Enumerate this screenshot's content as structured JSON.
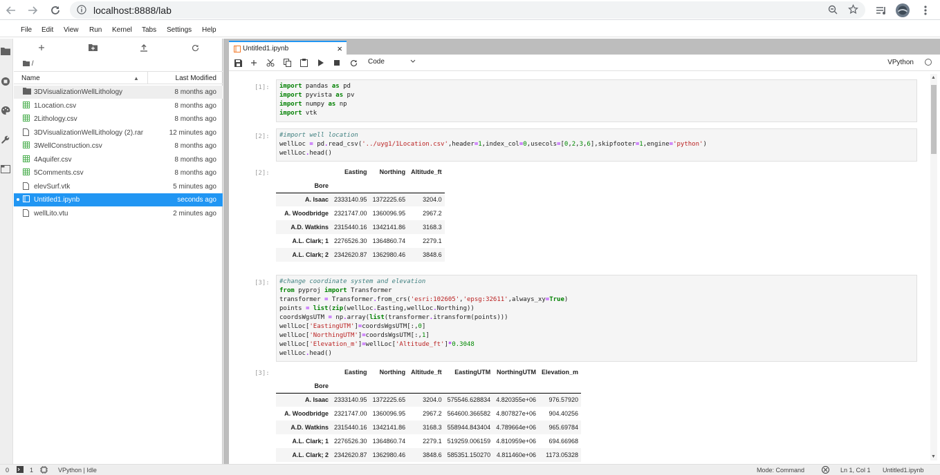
{
  "browser": {
    "url": "localhost:8888/lab"
  },
  "menubar": {
    "items": [
      "File",
      "Edit",
      "View",
      "Run",
      "Kernel",
      "Tabs",
      "Settings",
      "Help"
    ]
  },
  "filebrowser": {
    "breadcrumb": "/",
    "col_name": "Name",
    "col_modified": "Last Modified",
    "files": [
      {
        "name": "3DVisualizationWellLithology",
        "modified": "8 months ago",
        "kind": "folder"
      },
      {
        "name": "1Location.csv",
        "modified": "8 months ago",
        "kind": "csv"
      },
      {
        "name": "2Lithology.csv",
        "modified": "8 months ago",
        "kind": "csv"
      },
      {
        "name": "3DVisualizationWellLithology (2).rar",
        "modified": "12 minutes ago",
        "kind": "file"
      },
      {
        "name": "3WellConstruction.csv",
        "modified": "8 months ago",
        "kind": "csv"
      },
      {
        "name": "4Aquifer.csv",
        "modified": "8 months ago",
        "kind": "csv"
      },
      {
        "name": "5Comments.csv",
        "modified": "8 months ago",
        "kind": "csv"
      },
      {
        "name": "elevSurf.vtk",
        "modified": "5 minutes ago",
        "kind": "file"
      },
      {
        "name": "Untitled1.ipynb",
        "modified": "seconds ago",
        "kind": "notebook"
      },
      {
        "name": "wellLito.vtu",
        "modified": "2 minutes ago",
        "kind": "file"
      }
    ]
  },
  "tab": {
    "label": "Untitled1.ipynb",
    "close": "×"
  },
  "toolbar": {
    "cell_type": "Code",
    "kernel": "VPython"
  },
  "cells": {
    "c1_prompt": "[1]:",
    "c2_prompt": "[2]:",
    "o2_prompt": "[2]:",
    "c3_prompt": "[3]:",
    "o3_prompt": "[3]:"
  },
  "df1": {
    "columns": [
      "Easting",
      "Northing",
      "Altitude_ft"
    ],
    "index_name": "Bore",
    "rows": [
      {
        "bore": "A. Isaac",
        "easting": "2333140.95",
        "northing": "1372225.65",
        "alt": "3204.0"
      },
      {
        "bore": "A. Woodbridge",
        "easting": "2321747.00",
        "northing": "1360096.95",
        "alt": "2967.2"
      },
      {
        "bore": "A.D. Watkins",
        "easting": "2315440.16",
        "northing": "1342141.86",
        "alt": "3168.3"
      },
      {
        "bore": "A.L. Clark; 1",
        "easting": "2276526.30",
        "northing": "1364860.74",
        "alt": "2279.1"
      },
      {
        "bore": "A.L. Clark; 2",
        "easting": "2342620.87",
        "northing": "1362980.46",
        "alt": "3848.6"
      }
    ]
  },
  "df2": {
    "columns": [
      "Easting",
      "Northing",
      "Altitude_ft",
      "EastingUTM",
      "NorthingUTM",
      "Elevation_m"
    ],
    "index_name": "Bore",
    "rows": [
      {
        "bore": "A. Isaac",
        "easting": "2333140.95",
        "northing": "1372225.65",
        "alt": "3204.0",
        "eutm": "575546.628834",
        "nutm": "4.820355e+06",
        "elev": "976.57920"
      },
      {
        "bore": "A. Woodbridge",
        "easting": "2321747.00",
        "northing": "1360096.95",
        "alt": "2967.2",
        "eutm": "564600.366582",
        "nutm": "4.807827e+06",
        "elev": "904.40256"
      },
      {
        "bore": "A.D. Watkins",
        "easting": "2315440.16",
        "northing": "1342141.86",
        "alt": "3168.3",
        "eutm": "558944.843404",
        "nutm": "4.789664e+06",
        "elev": "965.69784"
      },
      {
        "bore": "A.L. Clark; 1",
        "easting": "2276526.30",
        "northing": "1364860.74",
        "alt": "2279.1",
        "eutm": "519259.006159",
        "nutm": "4.810959e+06",
        "elev": "694.66968"
      },
      {
        "bore": "A.L. Clark; 2",
        "easting": "2342620.87",
        "northing": "1362980.46",
        "alt": "3848.6",
        "eutm": "585351.150270",
        "nutm": "4.811460e+06",
        "elev": "1173.05328"
      }
    ]
  },
  "statusbar": {
    "zero": "0",
    "one": "1",
    "kernel_status": "VPython | Idle",
    "mode": "Mode: Command",
    "position": "Ln 1, Col 1",
    "file": "Untitled1.ipynb"
  }
}
